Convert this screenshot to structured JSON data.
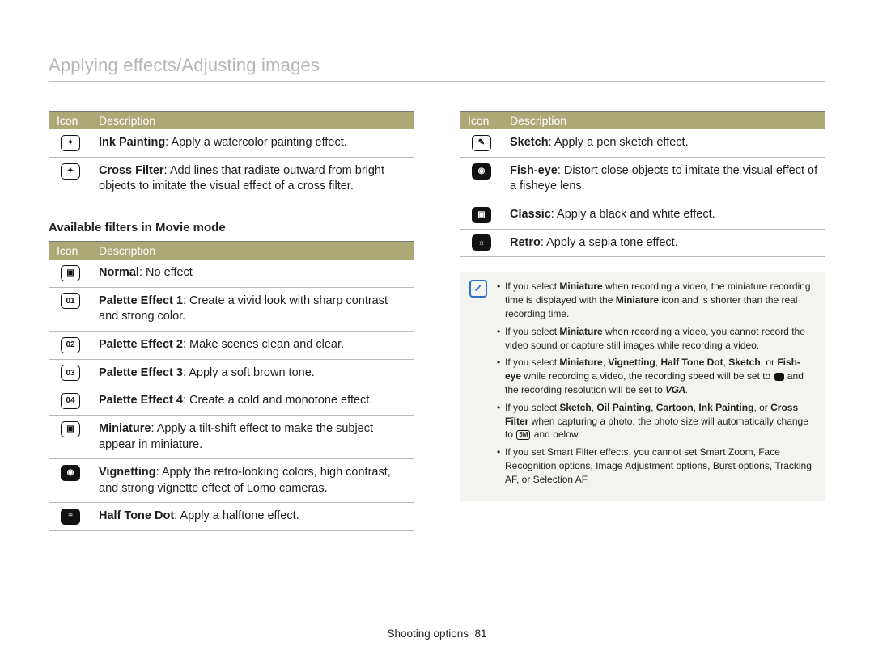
{
  "title": "Applying effects/Adjusting images",
  "headers": {
    "icon": "Icon",
    "desc": "Description"
  },
  "left_table_a": [
    {
      "icon_glyph": "✦",
      "name_b": "Ink Painting",
      "text": ": Apply a watercolor painting effect."
    },
    {
      "icon_glyph": "✦",
      "name_b": "Cross Filter",
      "text": ": Add lines that radiate outward from bright objects to imitate the visual effect of a cross filter."
    }
  ],
  "sub_heading": "Available filters in Movie mode",
  "left_table_b": [
    {
      "icon_glyph": "▣",
      "name_b": "Normal",
      "text": ": No effect"
    },
    {
      "icon_glyph": "01",
      "name_b": "Palette Effect 1",
      "text": ": Create a vivid look with sharp contrast and strong color."
    },
    {
      "icon_glyph": "02",
      "name_b": "Palette Effect 2",
      "text": ": Make scenes clean and clear."
    },
    {
      "icon_glyph": "03",
      "name_b": "Palette Effect 3",
      "text": ": Apply a soft brown tone."
    },
    {
      "icon_glyph": "04",
      "name_b": "Palette Effect 4",
      "text": ": Create a cold and monotone effect."
    },
    {
      "icon_glyph": "▣",
      "name_b": "Miniature",
      "text": ": Apply a tilt-shift effect to make the subject appear in miniature."
    },
    {
      "icon_glyph": "◉",
      "dark": true,
      "name_b": "Vignetting",
      "text": ": Apply the retro-looking colors, high contrast, and strong vignette effect of Lomo cameras."
    },
    {
      "icon_glyph": "≡",
      "dark": true,
      "name_b": "Half Tone Dot",
      "text": ": Apply a halftone effect."
    }
  ],
  "right_table": [
    {
      "icon_glyph": "✎",
      "name_b": "Sketch",
      "text": ": Apply a pen sketch effect."
    },
    {
      "icon_glyph": "◉",
      "dark": true,
      "name_b": "Fish-eye",
      "text": ": Distort close objects to imitate the visual effect of a fisheye lens."
    },
    {
      "icon_glyph": "▣",
      "dark": true,
      "name_b": "Classic",
      "text": ": Apply a black and white effect."
    },
    {
      "icon_glyph": "☼",
      "dark": true,
      "name_b": "Retro",
      "text": ": Apply a sepia tone effect."
    }
  ],
  "notes": {
    "n1_a": "If you select ",
    "n1_b": "Miniature",
    "n1_c": " when recording a video, the miniature recording time is displayed with the ",
    "n1_d": "Miniature",
    "n1_e": " icon and is shorter than the real recording time.",
    "n2_a": "If you select ",
    "n2_b": "Miniature",
    "n2_c": " when recording a video, you cannot record the video sound or capture still images while recording a video.",
    "n3_a": "If you select ",
    "n3_b": "Miniature",
    "n3_c": ", ",
    "n3_d": "Vignetting",
    "n3_e": ", ",
    "n3_f": "Half Tone Dot",
    "n3_g": ", ",
    "n3_h": "Sketch",
    "n3_i": ", or ",
    "n3_j": "Fish-eye",
    "n3_k": " while recording a video, the recording speed will be set to ",
    "n3_l": " and the recording resolution will be set to ",
    "n3_m": ".",
    "n4_a": "If you select ",
    "n4_b": "Sketch",
    "n4_c": ", ",
    "n4_d": "Oil Painting",
    "n4_e": ", ",
    "n4_f": "Cartoon",
    "n4_g": ", ",
    "n4_h": "Ink Painting",
    "n4_i": ", or ",
    "n4_j": "Cross Filter",
    "n4_k": " when capturing a photo, the photo size will automatically change to ",
    "n4_l": " and below.",
    "n5": "If you set Smart Filter effects, you cannot set Smart Zoom, Face Recognition options, Image Adjustment options, Burst options, Tracking AF, or Selection AF."
  },
  "inline": {
    "vga": "VGA",
    "res5m": "5M",
    "speed15": "15"
  },
  "footer": {
    "section": "Shooting options",
    "page": "81"
  }
}
